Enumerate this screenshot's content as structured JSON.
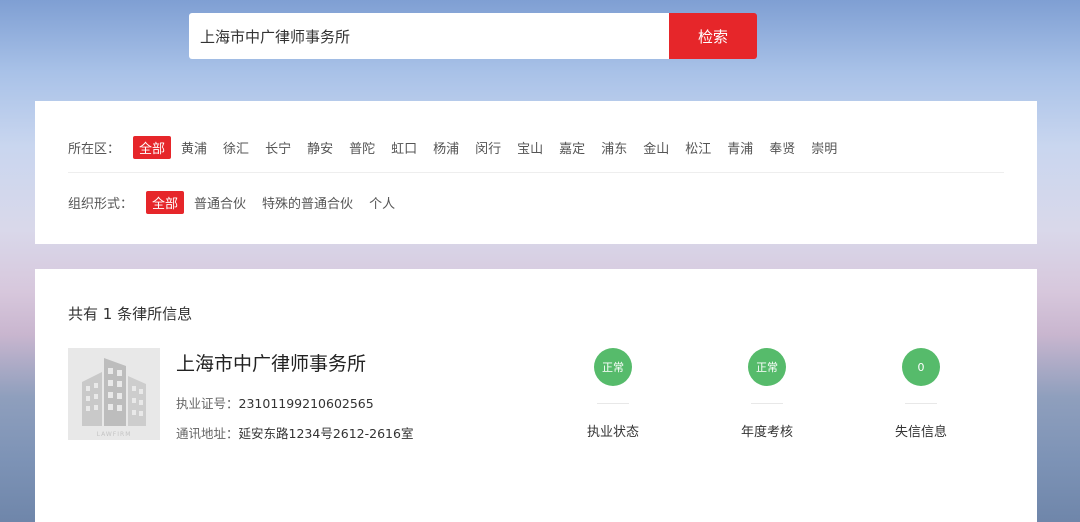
{
  "search": {
    "value": "上海市中广律师事务所",
    "button_label": "检索"
  },
  "filters": {
    "district": {
      "label": "所在区：",
      "options": [
        "全部",
        "黄浦",
        "徐汇",
        "长宁",
        "静安",
        "普陀",
        "虹口",
        "杨浦",
        "闵行",
        "宝山",
        "嘉定",
        "浦东",
        "金山",
        "松江",
        "青浦",
        "奉贤",
        "崇明"
      ],
      "selected": "全部"
    },
    "org_form": {
      "label": "组织形式：",
      "options": [
        "全部",
        "普通合伙",
        "特殊的普通合伙",
        "个人"
      ],
      "selected": "全部"
    }
  },
  "results": {
    "count_text": "共有 1 条律所信息",
    "items": [
      {
        "name": "上海市中广律师事务所",
        "thumb_icon": "building-icon",
        "thumb_caption": "LAWFIRM",
        "license_label": "执业证号：",
        "license_value": "23101199210602565",
        "address_label": "通讯地址：",
        "address_value": "延安东路1234号2612-2616室",
        "stats": [
          {
            "value": "正常",
            "label": "执业状态"
          },
          {
            "value": "正常",
            "label": "年度考核"
          },
          {
            "value": "0",
            "label": "失信信息"
          }
        ]
      }
    ]
  },
  "colors": {
    "accent": "#e6262a",
    "status_green": "#56bb6b"
  }
}
